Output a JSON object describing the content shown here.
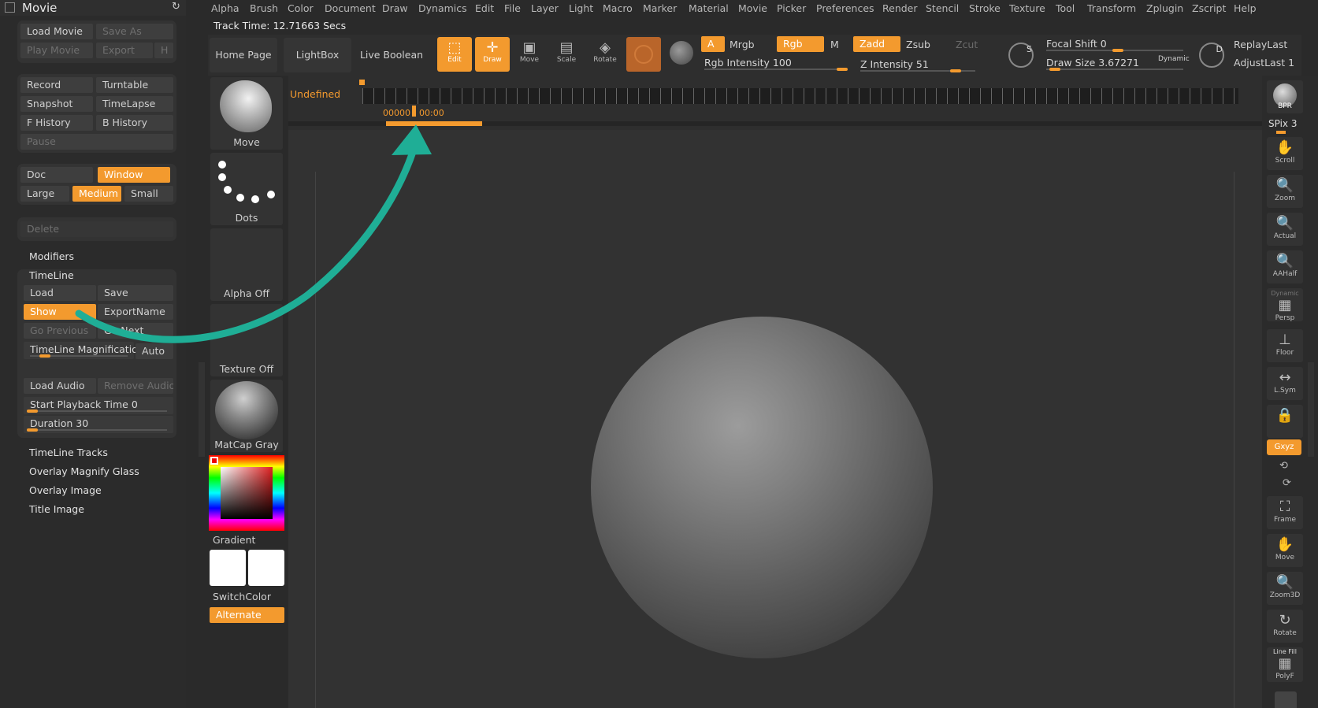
{
  "panel": {
    "title": "Movie",
    "row1": [
      "Load Movie",
      "Save As"
    ],
    "row2": [
      "Play Movie",
      "Export",
      "H"
    ],
    "record": "Record",
    "turntable": "Turntable",
    "snapshot": "Snapshot",
    "timelapse": "TimeLapse",
    "fhistory": "F History",
    "bhistory": "B History",
    "pause": "Pause",
    "doc": "Doc",
    "window": "Window",
    "large": "Large",
    "medium": "Medium",
    "small": "Small",
    "delete": "Delete",
    "modifiers": "Modifiers",
    "timeline": "TimeLine",
    "load": "Load",
    "save": "Save",
    "show": "Show",
    "exportname": "ExportName",
    "goprev": "Go Previous",
    "gonext": "Go Next",
    "tl_magnification": "TimeLine Magnification",
    "auto": "Auto",
    "load_audio": "Load Audio",
    "remove_audio": "Remove Audio",
    "start_playback": "Start Playback Time 0",
    "duration": "Duration 30",
    "timeline_tracks": "TimeLine Tracks",
    "overlay_magnify": "Overlay Magnify Glass",
    "overlay_image": "Overlay Image",
    "title_image": "Title Image"
  },
  "menu": [
    "Alpha",
    "Brush",
    "Color",
    "Document",
    "Draw",
    "Dynamics",
    "Edit",
    "File",
    "Layer",
    "Light",
    "Macro",
    "Marker",
    "Material",
    "Movie",
    "Picker",
    "Preferences",
    "Render",
    "Stencil",
    "Stroke",
    "Texture",
    "Tool",
    "Transform",
    "Zplugin",
    "Zscript",
    "Help"
  ],
  "toolbar": {
    "track_time": "Track Time: 12.71663 Secs",
    "home_page": "Home Page",
    "lightbox": "LightBox",
    "live_boolean": "Live Boolean",
    "edit": "Edit",
    "draw": "Draw",
    "move": "Move",
    "scale": "Scale",
    "rotate": "Rotate",
    "a": "A",
    "mrgb": "Mrgb",
    "rgb": "Rgb",
    "m": "M",
    "zadd": "Zadd",
    "zsub": "Zsub",
    "zcut": "Zcut",
    "rgb_intensity": "Rgb Intensity 100",
    "z_intensity": "Z Intensity 51",
    "focal_shift": "Focal Shift 0",
    "draw_size": "Draw Size 3.67271",
    "dynamic": "Dynamic",
    "replay_last": "ReplayLast",
    "adjust_last": "AdjustLast 1",
    "s": "S",
    "d": "D"
  },
  "timeline": {
    "undefined": "Undefined",
    "frame": "00000",
    "time": "00:00"
  },
  "tray": {
    "move": "Move",
    "dots": "Dots",
    "alpha_off": "Alpha Off",
    "texture_off": "Texture Off",
    "matcap": "MatCap Gray",
    "gradient": "Gradient",
    "switchcolor": "SwitchColor",
    "alternate": "Alternate"
  },
  "shelf": {
    "bpr": "BPR",
    "spix": "SPix 3",
    "scroll": "Scroll",
    "zoom": "Zoom",
    "actual": "Actual",
    "aahalf": "AAHalf",
    "dynamic": "Dynamic",
    "persp": "Persp",
    "floor": "Floor",
    "lsym": "L.Sym",
    "xyz": "Gxyz",
    "frame": "Frame",
    "move": "Move",
    "zoom3d": "Zoom3D",
    "rotate": "Rotate",
    "linefill": "Line Fill",
    "polyf": "PolyF"
  },
  "colors": {
    "accent": "#f39a2e",
    "arrow": "#1fae96"
  }
}
